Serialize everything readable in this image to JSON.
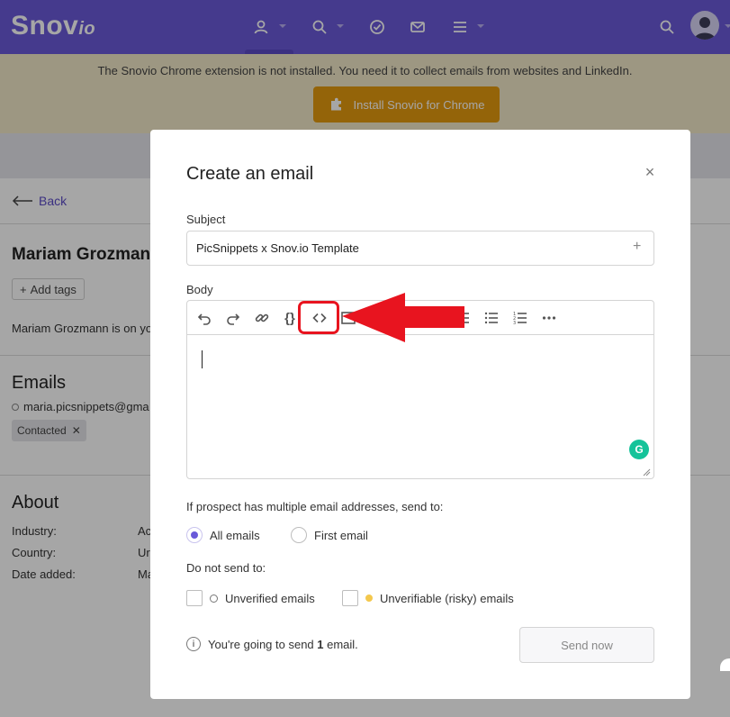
{
  "nav": {
    "logo_main": "Snov",
    "logo_sub": "io",
    "icons": [
      "user-icon",
      "search-icon",
      "check-circle-icon",
      "mail-icon",
      "menu-icon",
      "search-icon",
      "avatar-icon"
    ]
  },
  "banner": {
    "text": "The Snovio Chrome extension is not installed. You need it to collect emails from websites and LinkedIn.",
    "button_label": "Install Snovio for Chrome"
  },
  "page": {
    "back_label": "Back",
    "person_name": "Mariam Grozmann",
    "add_tags_label": "Add tags",
    "description": "Mariam Grozmann is on yo",
    "emails_title": "Emails",
    "email": "maria.picsnippets@gma",
    "contacted_label": "Contacted",
    "about_title": "About",
    "about": [
      {
        "label": "Industry:",
        "value": "Ac"
      },
      {
        "label": "Country:",
        "value": "Ur"
      },
      {
        "label": "Date added:",
        "value": "Ma"
      }
    ]
  },
  "modal": {
    "title": "Create an email",
    "close": "×",
    "subject_label": "Subject",
    "subject_value": "PicSnippets x Snov.io Template",
    "subject_plus": "+",
    "body_label": "Body",
    "toolbar": [
      "undo-icon",
      "redo-icon",
      "link-icon",
      "braces-icon",
      "code-view-icon",
      "image-icon",
      "align-icon",
      "bullet-list-icon",
      "numbered-list-icon",
      "more-icon"
    ],
    "multiple_label": "If prospect has multiple email addresses, send to:",
    "radio_all": "All emails",
    "radio_first": "First email",
    "selected_radio": "All emails",
    "do_not_send_label": "Do not send to:",
    "check_unverified": "Unverified emails",
    "check_risky": "Unverifiable (risky) emails",
    "info_prefix": "You're going to send ",
    "info_count": "1",
    "info_suffix": " email.",
    "send_button": "Send now"
  },
  "colors": {
    "brand": "#6a5ad9",
    "banner_bg": "#f2e8c8",
    "install_button": "#e49a0f",
    "annotation": "#e8141f",
    "grammarly": "#15c39a"
  }
}
